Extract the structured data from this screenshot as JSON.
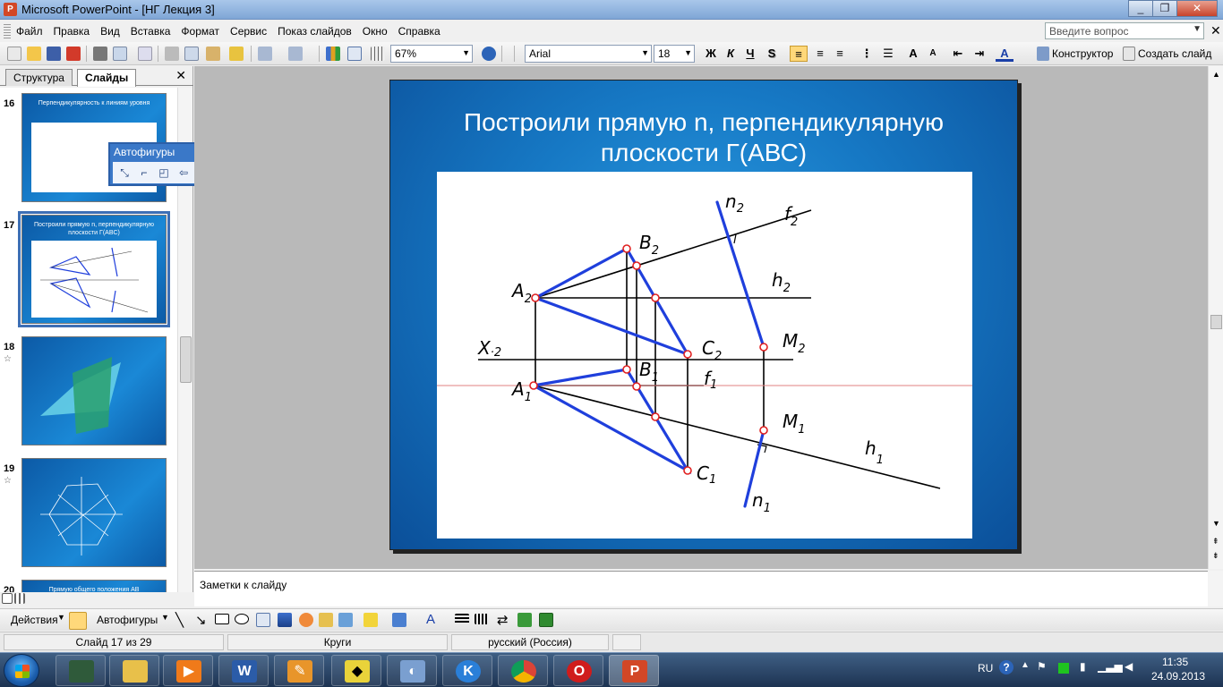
{
  "window": {
    "title": "Microsoft PowerPoint - [НГ Лекция 3]",
    "min": "_",
    "max": "❐",
    "close": "✕"
  },
  "menu": {
    "items": [
      "Файл",
      "Правка",
      "Вид",
      "Вставка",
      "Формат",
      "Сервис",
      "Показ слайдов",
      "Окно",
      "Справка"
    ],
    "help_placeholder": "Введите вопрос",
    "close": "✕"
  },
  "toolbar": {
    "zoom": "67%",
    "font": "Arial",
    "size": "18",
    "bold": "Ж",
    "italic": "К",
    "underline": "Ч",
    "shadow": "S",
    "designer": "Конструктор",
    "new_slide": "Создать слайд"
  },
  "left_panel": {
    "tabs": [
      "Структура",
      "Слайды"
    ],
    "close": "✕",
    "thumbs": [
      {
        "num": "16",
        "text": "Перпендикулярность к линиям уровня"
      },
      {
        "num": "17",
        "text": "Построили прямую n, перпендикулярную плоскости Г(ABC)"
      },
      {
        "num": "18",
        "text": ""
      },
      {
        "num": "19",
        "text": ""
      },
      {
        "num": "20",
        "text": "Прямую общего положения АВ преобразовать"
      }
    ]
  },
  "autoshapes_toolbar": {
    "title": "Автофигуры",
    "menu": "▼",
    "close": "✕"
  },
  "slide": {
    "title": "Построили прямую n, перпендикулярную плоскости Г(АВС)",
    "labels": {
      "n2": "n",
      "n2sub": "2",
      "f2": "f",
      "f2sub": "2",
      "B2": "B",
      "B2sub": "2",
      "h2": "h",
      "h2sub": "2",
      "A2": "A",
      "A2sub": "2",
      "X": "X",
      "Xsub": "·2",
      "C2": "C",
      "C2sub": "2",
      "M2": "M",
      "M2sub": "2",
      "B1": "B",
      "B1sub": "1",
      "f1": "f",
      "f1sub": "1",
      "A1": "A",
      "A1sub": "1",
      "M1": "M",
      "M1sub": "1",
      "h1": "h",
      "h1sub": "1",
      "C1": "C",
      "C1sub": "1",
      "n1": "n",
      "n1sub": "1"
    }
  },
  "notes": {
    "placeholder": "Заметки к слайду"
  },
  "drawbar": {
    "actions": "Действия",
    "autoshapes": "Автофигуры"
  },
  "status": {
    "slide": "Слайд 17 из 29",
    "design": "Круги",
    "lang": "русский (Россия)"
  },
  "tray": {
    "lang": "RU",
    "time": "11:35",
    "date": "24.09.2013"
  },
  "colors": {
    "accent": "#3a78c8",
    "slide_blue": "#1678c4",
    "construction_blue": "#1f3fdc",
    "point_red": "#e02020"
  }
}
